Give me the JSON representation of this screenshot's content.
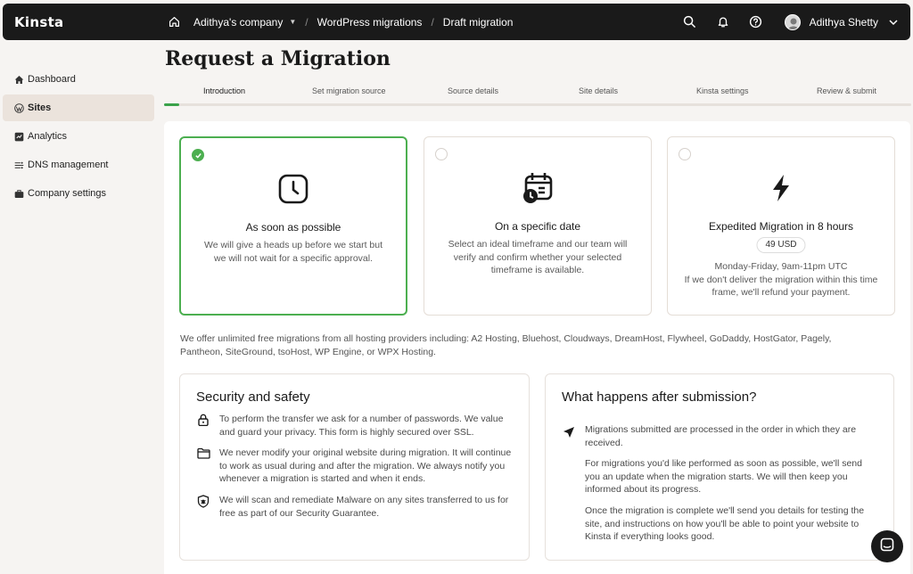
{
  "app": {
    "logo": "Kinsta"
  },
  "breadcrumb": {
    "company": "Adithya's company",
    "section": "WordPress migrations",
    "current": "Draft migration"
  },
  "user": {
    "name": "Adithya Shetty"
  },
  "sidebar": {
    "items": [
      {
        "label": "Dashboard",
        "icon": "home-icon"
      },
      {
        "label": "Sites",
        "icon": "wordpress-icon",
        "active": true
      },
      {
        "label": "Analytics",
        "icon": "chart-icon"
      },
      {
        "label": "DNS management",
        "icon": "dns-icon"
      },
      {
        "label": "Company settings",
        "icon": "briefcase-icon"
      }
    ]
  },
  "page": {
    "title": "Request a Migration"
  },
  "steps": {
    "items": [
      "Introduction",
      "Set migration source",
      "Source details",
      "Site details",
      "Kinsta settings",
      "Review & submit"
    ],
    "active_index": 0,
    "progress": 0.02
  },
  "options": [
    {
      "title": "As soon as possible",
      "desc": "We will give a heads up before we start but we will not wait for a specific approval.",
      "icon": "clock-icon",
      "selected": true
    },
    {
      "title": "On a specific date",
      "desc": "Select an ideal timeframe and our team will verify and confirm whether your selected timeframe is available.",
      "icon": "calendar-clock-icon",
      "selected": false
    },
    {
      "title": "Expedited Migration in 8 hours",
      "price": "49 USD",
      "hours": "Monday-Friday, 9am-11pm UTC",
      "desc": "If we don't deliver the migration within this time frame, we'll refund your payment.",
      "icon": "lightning-icon",
      "selected": false
    }
  ],
  "free_note": "We offer unlimited free migrations from all hosting providers including: A2 Hosting, Bluehost, Cloudways, DreamHost, Flywheel, GoDaddy, HostGator, Pagely, Pantheon, SiteGround, tsoHost, WP Engine, or WPX Hosting.",
  "security": {
    "title": "Security and safety",
    "items": [
      {
        "text": "To perform the transfer we ask for a number of passwords. We value and guard your privacy. This form is highly secured over SSL.",
        "icon": "lock-icon"
      },
      {
        "text": "We never modify your original website during migration. It will continue to work as usual during and after the migration. We always notify you whenever a migration is started and when it ends.",
        "icon": "folder-icon"
      },
      {
        "text": "We will scan and remediate Malware on any sites transferred to us for free as part of our Security Guarantee.",
        "icon": "shield-bug-icon"
      }
    ]
  },
  "after": {
    "title": "What happens after submission?",
    "paragraphs": [
      "Migrations submitted are processed in the order in which they are received.",
      "For migrations you'd like performed as soon as possible, we'll send you an update when the migration starts. We will then keep you informed about its progress.",
      "Once the migration is complete we'll send you details for testing the site, and instructions on how you'll be able to point your website to Kinsta if everything looks good."
    ]
  },
  "colors": {
    "accent": "#4caf50",
    "topbar": "#1a1a1a",
    "active_nav": "#ebe3dc"
  }
}
